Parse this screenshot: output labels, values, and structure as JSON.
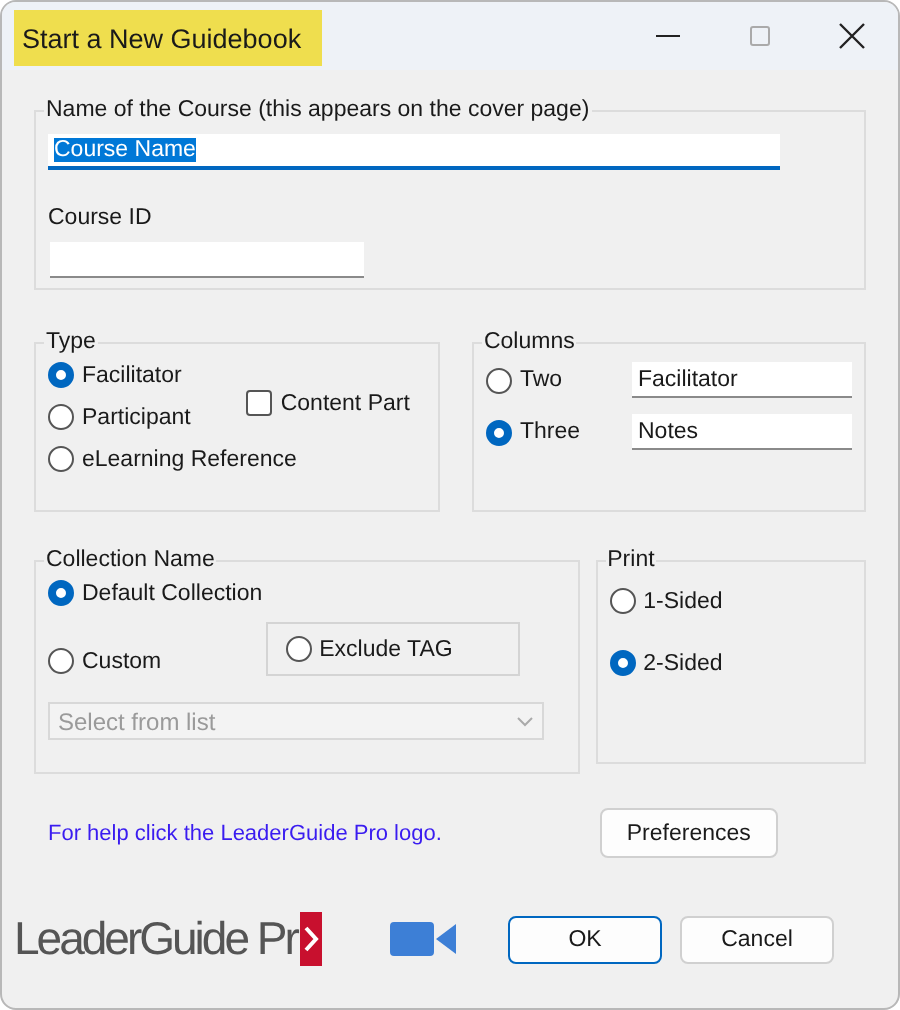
{
  "window": {
    "title": "Start a New Guidebook"
  },
  "course": {
    "legend": "Name of the Course (this appears on the cover page)",
    "name_value": "Course Name",
    "name_selected": true,
    "id_label": "Course ID"
  },
  "type": {
    "legend": "Type",
    "options": [
      {
        "label": "Facilitator",
        "selected": true
      },
      {
        "label": "Participant",
        "selected": false
      },
      {
        "label": "eLearning Reference",
        "selected": false
      }
    ],
    "content_part": {
      "label": "Content Part",
      "checked": false
    }
  },
  "columns": {
    "legend": "Columns",
    "options": [
      {
        "label": "Two",
        "selected": false,
        "field": "Facilitator"
      },
      {
        "label": "Three",
        "selected": true,
        "field": "Notes"
      }
    ]
  },
  "collection": {
    "legend": "Collection Name",
    "options": [
      {
        "label": "Default Collection",
        "selected": true
      },
      {
        "label": "Custom",
        "selected": false
      }
    ],
    "exclude": {
      "label": "Exclude TAG",
      "selected": false
    },
    "dropdown": {
      "placeholder": "Select from list",
      "disabled": true
    }
  },
  "print": {
    "legend": "Print",
    "options": [
      {
        "label": "1-Sided",
        "selected": false
      },
      {
        "label": "2-Sided",
        "selected": true
      }
    ]
  },
  "help_link": "For help click the LeaderGuide Pro logo.",
  "preferences_button": "Preferences",
  "logo": "LeaderGuide Pr",
  "buttons": [
    {
      "label": "OK",
      "kind": "default"
    },
    {
      "label": "Cancel",
      "kind": "normal"
    }
  ]
}
